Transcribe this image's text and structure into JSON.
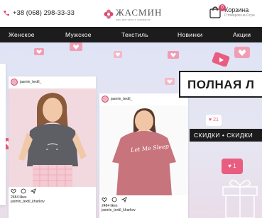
{
  "header": {
    "phone": "+38 (068) 298-33-33",
    "logo_title": "ЖАСМИН",
    "logo_subtitle": "ваш для уюта и комфорта",
    "cart_title": "Корзина",
    "cart_subtitle": "0 товаров на 0 грн",
    "cart_count": "0"
  },
  "nav": {
    "items": [
      {
        "label": "Женское"
      },
      {
        "label": "Мужское"
      },
      {
        "label": "Текстиль"
      },
      {
        "label": "Новинки"
      },
      {
        "label": "Акции"
      }
    ]
  },
  "banner": {
    "promo_title": "ПОЛНАЯ Л",
    "discount_strip": "СКИДКИ • СКИДКИ",
    "heart_badge_count": "1",
    "notification_count": "21",
    "cards": [
      {
        "username": "jasmin_textil_",
        "likes": "2484 likes",
        "caption": "jasmin_textil_kharkov"
      },
      {
        "username": "jasmin_textil_",
        "likes": "2484 likes",
        "caption": "jasmin_textil_kharkov",
        "shirt_text": "Let Me Sleep"
      }
    ]
  },
  "colors": {
    "brand_pink": "#d9486d",
    "nav_bg": "#1c1c1c",
    "banner_bg": "#e3e3f3"
  }
}
